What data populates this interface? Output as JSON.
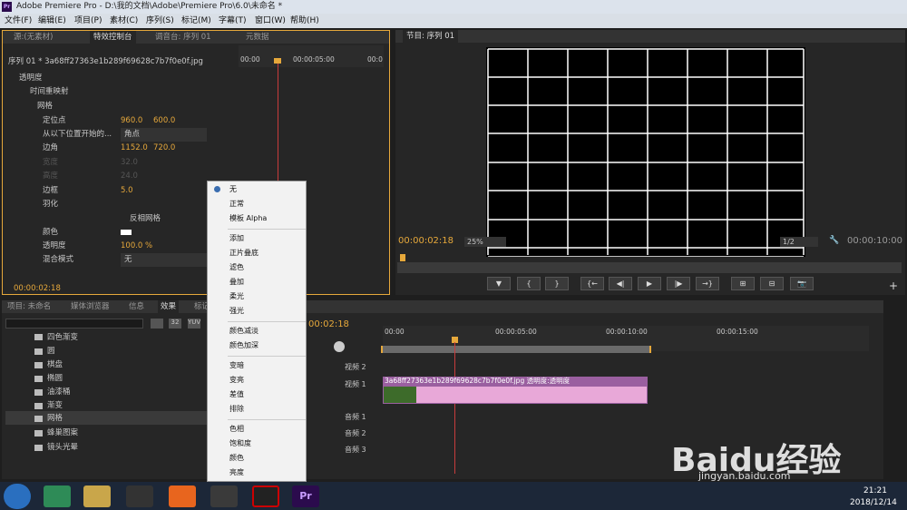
{
  "window": {
    "app_icon": "Pr",
    "title": "Adobe Premiere Pro - D:\\我的文档\\Adobe\\Premiere Pro\\6.0\\未命名 *"
  },
  "menu": [
    "文件(F)",
    "编辑(E)",
    "项目(P)",
    "素材(C)",
    "序列(S)",
    "标记(M)",
    "字幕(T)",
    "窗口(W)",
    "帮助(H)"
  ],
  "source_tabs": {
    "source": "源:(无素材)",
    "effects_control": "特效控制台",
    "mixer": "调音台: 序列 01",
    "metadata": "元数据"
  },
  "ec": {
    "clip": "序列 01 * 3a68ff27363e1b289f69628c7b7f0e0f.jpg",
    "tc_start": "00:00",
    "tc_mid": "00:00:05:00",
    "tc_end": "00:0",
    "props": {
      "opacity": "透明度",
      "time_remap": "时间重映射",
      "grid": "网格",
      "anchor": "定位点",
      "anchor_x": "960.0",
      "anchor_y": "600.0",
      "start_from": "从以下位置开始的...",
      "corner_option": "角点",
      "corner": "边角",
      "corner_x": "1152.0",
      "corner_y": "720.0",
      "width": "宽度",
      "width_val": "32.0",
      "height": "高度",
      "height_val": "24.0",
      "border": "边框",
      "border_val": "5.0",
      "feather": "羽化",
      "invert": "反相网格",
      "color": "颜色",
      "grid_opacity": "透明度",
      "opacity_val": "100.0 %",
      "blend": "混合模式",
      "blend_val": "无"
    },
    "timecode": "00:00:02:18"
  },
  "program": {
    "tab": "节目: 序列 01",
    "timecode": "00:00:02:18",
    "zoom": "25%",
    "quality": "1/2",
    "duration": "00:00:10:00"
  },
  "project_tabs": {
    "project": "项目: 未命名",
    "media": "媒体浏览器",
    "info": "信息",
    "effects": "效果",
    "markers": "标记"
  },
  "effects_list": [
    "四色渐变",
    "圆",
    "棋盘",
    "椭圆",
    "油漆桶",
    "渐变",
    "网格",
    "蜂巢图案",
    "镜头光晕"
  ],
  "timeline": {
    "timecode": "00:02:18",
    "t0": "00:00",
    "t5": "00:00:05:00",
    "t10": "00:00:10:00",
    "t15": "00:00:15:00",
    "v2": "视频 2",
    "v1": "视频 1",
    "a1": "音频 1",
    "a2": "音频 2",
    "a3": "音频 3",
    "clip_label": "3a68ff27363e1b289f69628c7b7f0e0f.jpg 透明度:透明度"
  },
  "context_menu": [
    "无",
    "正常",
    "模板 Alpha",
    "添加",
    "正片叠底",
    "滤色",
    "叠加",
    "柔光",
    "强光",
    "颜色减淡",
    "颜色加深",
    "变暗",
    "变亮",
    "差值",
    "排除",
    "色相",
    "饱和度",
    "颜色",
    "亮度"
  ],
  "taskbar": {
    "time": "21:21",
    "date": "2018/12/14",
    "app": "Pr"
  },
  "watermark": "Baidu经验",
  "watermark_url": "jingyan.baidu.com",
  "colors": {
    "accent": "#e6a83b",
    "playhead": "#c83c3c",
    "clip_pink": "#e8a8d8",
    "clip_header": "#9a5fa0"
  }
}
